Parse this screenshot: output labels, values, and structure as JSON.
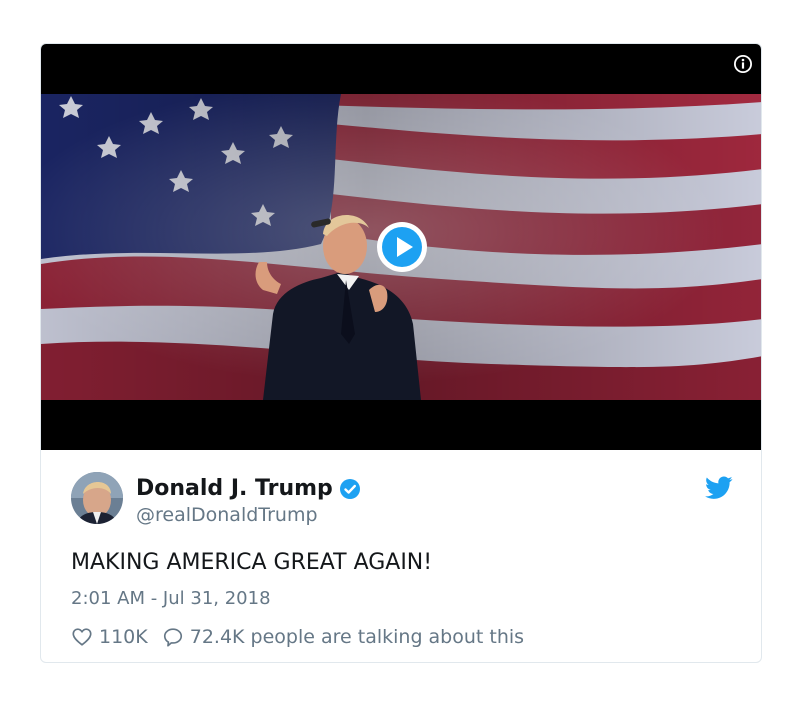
{
  "tweet": {
    "author_name": "Donald J. Trump",
    "handle": "@realDonaldTrump",
    "text": "MAKING AMERICA GREAT AGAIN!",
    "timestamp": "2:01 AM - Jul 31, 2018",
    "likes": "110K",
    "talking": "72.4K people are talking about this"
  },
  "icons": {
    "verified": "verified-badge-icon",
    "bird": "twitter-bird-icon",
    "heart": "heart-icon",
    "comment": "comment-icon",
    "info": "info-icon",
    "play": "play-icon"
  },
  "colors": {
    "twitter_blue": "#1da1f2",
    "text": "#14171a",
    "muted": "#657786",
    "border": "#e1e8ed"
  }
}
